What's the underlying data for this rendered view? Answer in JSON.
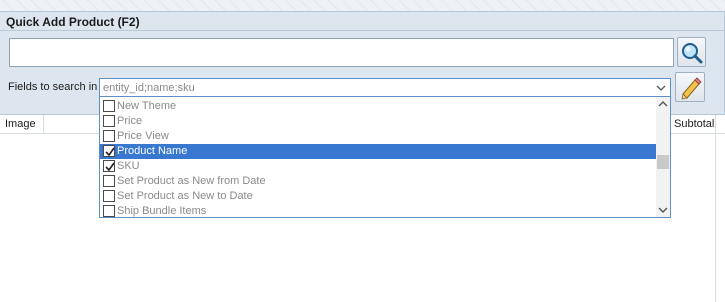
{
  "panel": {
    "title": "Quick Add Product (F2)"
  },
  "search": {
    "value": "",
    "placeholder": "",
    "button_icon": "magnifier-icon"
  },
  "fields": {
    "label": "Fields to search in",
    "value": "entity_id;name;sku",
    "edit_icon": "pencil-icon"
  },
  "dropdown": {
    "items": [
      {
        "label": "New Theme",
        "checked": false,
        "selected": false
      },
      {
        "label": "Price",
        "checked": false,
        "selected": false
      },
      {
        "label": "Price View",
        "checked": false,
        "selected": false
      },
      {
        "label": "Product Name",
        "checked": true,
        "selected": true
      },
      {
        "label": "SKU",
        "checked": true,
        "selected": false
      },
      {
        "label": "Set Product as New from Date",
        "checked": false,
        "selected": false
      },
      {
        "label": "Set Product as New to Date",
        "checked": false,
        "selected": false
      },
      {
        "label": "Ship Bundle Items",
        "checked": false,
        "selected": false
      }
    ]
  },
  "grid": {
    "columns": {
      "image": "Image",
      "subtotal": "Subtotal"
    }
  },
  "colors": {
    "selection": "#3878d0",
    "panel_bg": "#dde6ef",
    "focus_border": "#5e8fc5"
  }
}
